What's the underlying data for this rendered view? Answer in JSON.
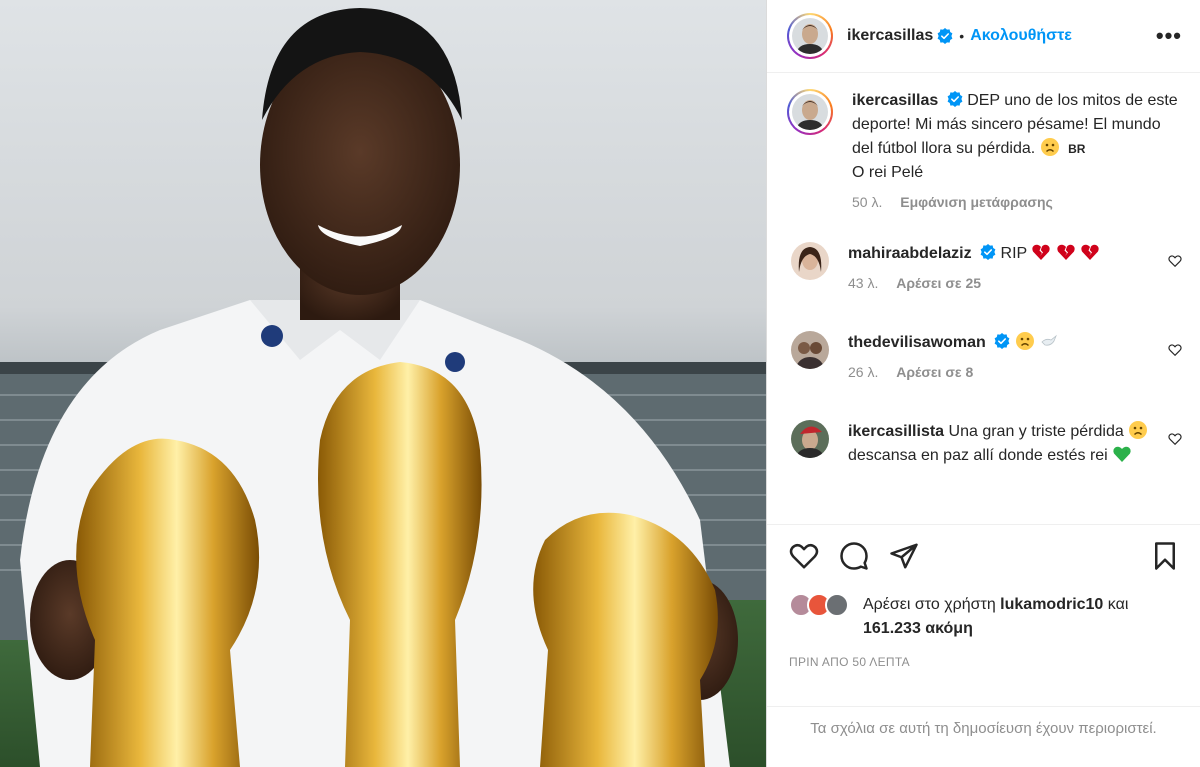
{
  "post": {
    "username": "ikercasillas",
    "follow_label": "Ακολουθήστε",
    "separator": "•",
    "more_label": "•••"
  },
  "caption": {
    "username": "ikercasillas",
    "text": "DEP uno de los mitos de este deporte! Mi más sincero pésame! El mundo del fútbol llora su pérdida.",
    "flag": "BR",
    "line2": "O rei Pelé",
    "time": "50 λ.",
    "translate_label": "Εμφάνιση μετάφρασης"
  },
  "comments": [
    {
      "username": "mahiraabdelaziz",
      "text": "RIP",
      "emoji_names": [
        "broken-heart",
        "broken-heart",
        "broken-heart"
      ],
      "time": "43 λ.",
      "likes_label": "Αρέσει σε 25"
    },
    {
      "username": "thedevilisawoman",
      "text": "",
      "emoji_names": [
        "sad-face",
        "dove"
      ],
      "time": "26 λ.",
      "likes_label": "Αρέσει σε 8"
    },
    {
      "username": "ikercasillista",
      "text_part1": "Una gran y triste pérdida",
      "text_part2": "descansa en paz allí donde estés rei",
      "emoji_names": [
        "sad-face",
        "green-heart"
      ]
    }
  ],
  "likes": {
    "prefix": "Αρέσει στο χρήστη",
    "user": "lukamodric10",
    "connector": "και",
    "count": "161.233 ακόμη"
  },
  "timestamp": "ΠΡΙΝ ΑΠΟ 50 ΛΕΠΤΑ",
  "restricted_notice": "Τα σχόλια σε αυτή τη δημοσίευση έχουν περιοριστεί.",
  "colors": {
    "accent": "#0095f6",
    "muted": "#8e8e8e",
    "text": "#262626",
    "broken_heart": "#d0021b",
    "green_heart": "#2bb14a"
  }
}
